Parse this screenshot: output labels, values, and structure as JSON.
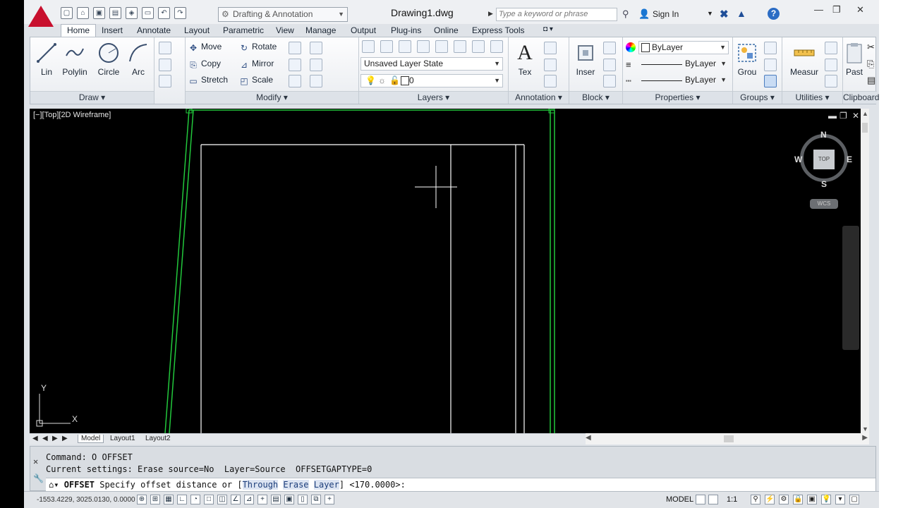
{
  "titlebar": {
    "workspace": "Drafting & Annotation",
    "document_title": "Drawing1.dwg",
    "search_placeholder": "Type a keyword or phrase",
    "sign_in": "Sign In",
    "help": "?"
  },
  "tabs": [
    "Home",
    "Insert",
    "Annotate",
    "Layout",
    "Parametric",
    "View",
    "Manage",
    "Output",
    "Plug-ins",
    "Online",
    "Express Tools"
  ],
  "ribbon": {
    "draw": {
      "title": "Draw",
      "line": "Lin",
      "polyline": "Polylin",
      "circle": "Circle",
      "arc": "Arc"
    },
    "modify": {
      "title": "Modify",
      "move": "Move",
      "rotate": "Rotate",
      "copy": "Copy",
      "mirror": "Mirror",
      "stretch": "Stretch",
      "scale": "Scale"
    },
    "layers": {
      "title": "Layers",
      "layer_state": "Unsaved Layer State",
      "current_layer": "0"
    },
    "annotation": {
      "title": "Annotation",
      "text": "Tex"
    },
    "block": {
      "title": "Block",
      "insert": "Inser"
    },
    "properties": {
      "title": "Properties",
      "color": "ByLayer",
      "linetype": "ByLayer",
      "lineweight": "ByLayer"
    },
    "groups": {
      "title": "Groups",
      "group": "Grou"
    },
    "utilities": {
      "title": "Utilities",
      "measure": "Measur"
    },
    "clipboard": {
      "title": "Clipboard",
      "paste": "Past"
    }
  },
  "viewport": {
    "label": "[−][Top][2D Wireframe]",
    "viewcube": {
      "north": "N",
      "south": "S",
      "east": "E",
      "west": "W",
      "face": "TOP",
      "ucs": "WCS"
    },
    "ucs_x": "X",
    "ucs_y": "Y"
  },
  "layout_tabs": [
    "Model",
    "Layout1",
    "Layout2"
  ],
  "command": {
    "history_1": "Command: O OFFSET",
    "history_2": "Current settings: Erase source=No  Layer=Source  OFFSETGAPTYPE=0",
    "prompt_cmd": "OFFSET",
    "prompt_text": "Specify offset distance or [",
    "opt_through": "Through",
    "opt_erase": "Erase",
    "opt_layer": "Layer",
    "prompt_end": "] <170.0000>:"
  },
  "status": {
    "coordinates": "-1553.4229, 3025.0130, 0.0000",
    "model": "MODEL",
    "scale": "1:1"
  },
  "colors": {
    "accent": "#c8102e",
    "geometry_green": "#22c83c",
    "geometry_white": "#ffffff",
    "canvas": "#000000"
  }
}
